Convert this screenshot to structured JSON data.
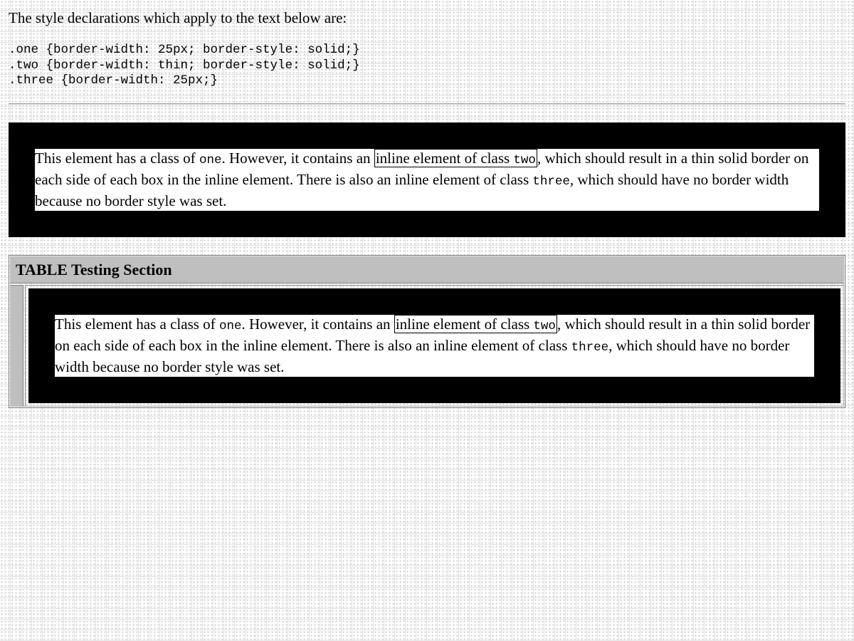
{
  "intro": "The style declarations which apply to the text below are:",
  "css_rules": [
    ".one {border-width: 25px; border-style: solid;}",
    ".two {border-width: thin; border-style: solid;}",
    ".three {border-width: 25px;}"
  ],
  "paragraph": {
    "part1": "This element has a class of ",
    "class_one": "one",
    "part2": ". However, it contains an ",
    "inline_two_text": "inline element of class ",
    "class_two": "two",
    "part3": ", which should result in a thin solid border on each side of each box in the inline element. There is also an inline element of class ",
    "class_three": "three",
    "part4": ", which should have no border width because no border style was set."
  },
  "table": {
    "heading": "TABLE Testing Section"
  }
}
